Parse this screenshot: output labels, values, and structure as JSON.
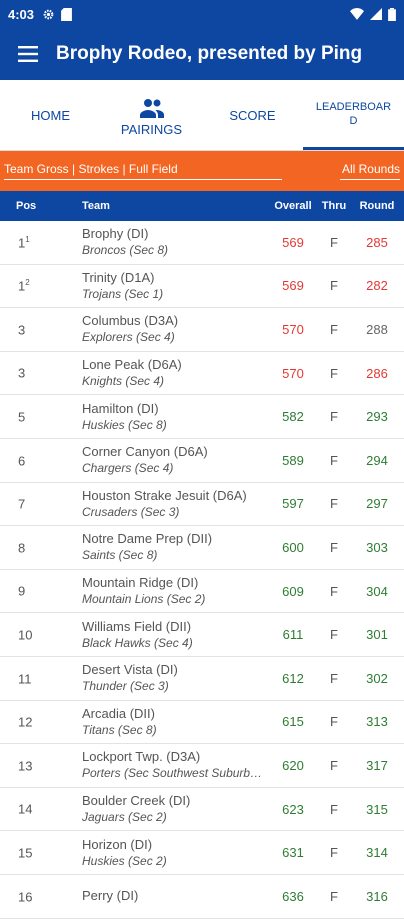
{
  "status": {
    "time": "4:03"
  },
  "app": {
    "title": "Brophy Rodeo, presented by Ping"
  },
  "tabs": [
    {
      "label": "HOME"
    },
    {
      "label": "PAIRINGS"
    },
    {
      "label": "SCORE"
    },
    {
      "label": "LEADERBOARD"
    }
  ],
  "filter": {
    "left": "Team Gross | Strokes | Full Field",
    "right": "All Rounds"
  },
  "table": {
    "headers": {
      "pos": "Pos",
      "team": "Team",
      "overall": "Overall",
      "thru": "Thru",
      "round": "Round"
    },
    "rows": [
      {
        "pos": "1",
        "sup": "1",
        "team": "Brophy (DI)",
        "mascot": "Broncos (Sec 8)",
        "overall": "569",
        "overall_color": "red",
        "thru": "F",
        "round": "285",
        "round_color": "red"
      },
      {
        "pos": "1",
        "sup": "2",
        "team": "Trinity (D1A)",
        "mascot": "Trojans (Sec 1)",
        "overall": "569",
        "overall_color": "red",
        "thru": "F",
        "round": "282",
        "round_color": "red"
      },
      {
        "pos": "3",
        "sup": "",
        "team": "Columbus (D3A)",
        "mascot": "Explorers (Sec 4)",
        "overall": "570",
        "overall_color": "red",
        "thru": "F",
        "round": "288",
        "round_color": "gray"
      },
      {
        "pos": "3",
        "sup": "",
        "team": "Lone Peak (D6A)",
        "mascot": "Knights (Sec 4)",
        "overall": "570",
        "overall_color": "red",
        "thru": "F",
        "round": "286",
        "round_color": "red"
      },
      {
        "pos": "5",
        "sup": "",
        "team": "Hamilton (DI)",
        "mascot": "Huskies (Sec 8)",
        "overall": "582",
        "overall_color": "green",
        "thru": "F",
        "round": "293",
        "round_color": "green"
      },
      {
        "pos": "6",
        "sup": "",
        "team": "Corner Canyon (D6A)",
        "mascot": "Chargers (Sec 4)",
        "overall": "589",
        "overall_color": "green",
        "thru": "F",
        "round": "294",
        "round_color": "green"
      },
      {
        "pos": "7",
        "sup": "",
        "team": "Houston Strake Jesuit (D6A)",
        "mascot": "Crusaders (Sec 3)",
        "overall": "597",
        "overall_color": "green",
        "thru": "F",
        "round": "297",
        "round_color": "green"
      },
      {
        "pos": "8",
        "sup": "",
        "team": "Notre Dame Prep (DII)",
        "mascot": "Saints (Sec 8)",
        "overall": "600",
        "overall_color": "green",
        "thru": "F",
        "round": "303",
        "round_color": "green"
      },
      {
        "pos": "9",
        "sup": "",
        "team": "Mountain Ridge (DI)",
        "mascot": "Mountain Lions (Sec 2)",
        "overall": "609",
        "overall_color": "green",
        "thru": "F",
        "round": "304",
        "round_color": "green"
      },
      {
        "pos": "10",
        "sup": "",
        "team": "Williams Field (DII)",
        "mascot": "Black Hawks (Sec 4)",
        "overall": "611",
        "overall_color": "green",
        "thru": "F",
        "round": "301",
        "round_color": "green"
      },
      {
        "pos": "11",
        "sup": "",
        "team": "Desert Vista (DI)",
        "mascot": "Thunder (Sec 3)",
        "overall": "612",
        "overall_color": "green",
        "thru": "F",
        "round": "302",
        "round_color": "green"
      },
      {
        "pos": "12",
        "sup": "",
        "team": "Arcadia (DII)",
        "mascot": "Titans (Sec 8)",
        "overall": "615",
        "overall_color": "green",
        "thru": "F",
        "round": "313",
        "round_color": "green"
      },
      {
        "pos": "13",
        "sup": "",
        "team": "Lockport Twp. (D3A)",
        "mascot": "Porters (Sec Southwest Suburban)",
        "overall": "620",
        "overall_color": "green",
        "thru": "F",
        "round": "317",
        "round_color": "green"
      },
      {
        "pos": "14",
        "sup": "",
        "team": "Boulder Creek (DI)",
        "mascot": "Jaguars (Sec 2)",
        "overall": "623",
        "overall_color": "green",
        "thru": "F",
        "round": "315",
        "round_color": "green"
      },
      {
        "pos": "15",
        "sup": "",
        "team": "Horizon (DI)",
        "mascot": "Huskies (Sec 2)",
        "overall": "631",
        "overall_color": "green",
        "thru": "F",
        "round": "314",
        "round_color": "green"
      },
      {
        "pos": "16",
        "sup": "",
        "team": "Perry (DI)",
        "mascot": "",
        "overall": "636",
        "overall_color": "green",
        "thru": "F",
        "round": "316",
        "round_color": "green"
      }
    ]
  }
}
